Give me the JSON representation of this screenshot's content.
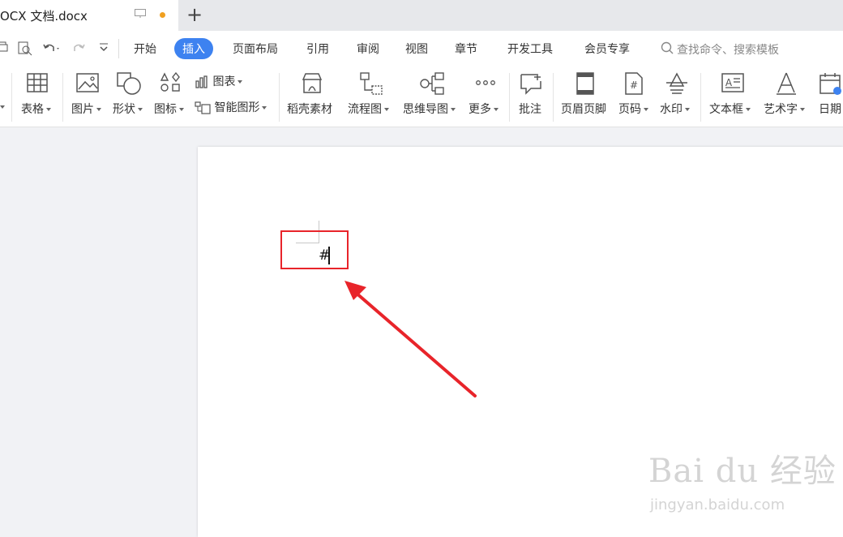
{
  "tab": {
    "title": "OCX 文档.docx"
  },
  "menu": {
    "items": [
      "开始",
      "插入",
      "页面布局",
      "引用",
      "审阅",
      "视图",
      "章节",
      "开发工具",
      "会员专享"
    ],
    "active": "插入",
    "search_placeholder": "查找命令、搜索模板"
  },
  "ribbon": {
    "table": "表格",
    "picture": "图片",
    "shape": "形状",
    "icon": "图标",
    "chart": "图表",
    "smart_art": "智能图形",
    "daoke": "稻壳素材",
    "flowchart": "流程图",
    "mindmap": "思维导图",
    "more": "更多",
    "comment": "批注",
    "header_footer": "页眉页脚",
    "page_number": "页码",
    "watermark": "水印",
    "textbox": "文本框",
    "wordart": "艺术字",
    "date": "日期"
  },
  "document": {
    "text": "#"
  },
  "watermark": {
    "main": "Bai du 经验",
    "sub": "jingyan.baidu.com"
  },
  "colors": {
    "accent": "#3d82f0",
    "highlight": "#e8242a",
    "dot": "#f0a020"
  }
}
